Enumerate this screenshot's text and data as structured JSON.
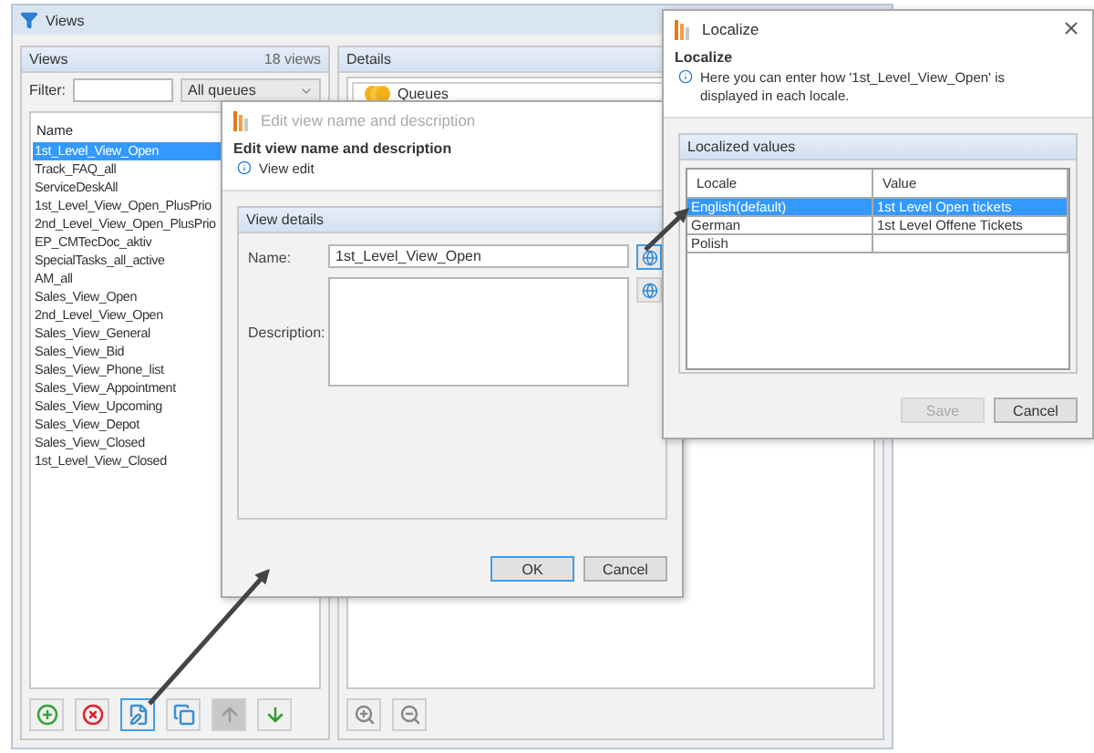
{
  "window": {
    "title": "Views"
  },
  "views_panel": {
    "title": "Views",
    "count": "18 views",
    "filter_label": "Filter:",
    "queue_select": "All queues",
    "column": "Name",
    "items": [
      {
        "label": "1st_Level_View_Open",
        "selected": true
      },
      {
        "label": "Track_FAQ_all",
        "selected": false
      },
      {
        "label": "ServiceDeskAll",
        "selected": false
      },
      {
        "label": "1st_Level_View_Open_PlusPrio",
        "selected": false
      },
      {
        "label": "2nd_Level_View_Open_PlusPrio",
        "selected": false
      },
      {
        "label": "EP_CMTecDoc_aktiv",
        "selected": false
      },
      {
        "label": "SpecialTasks_all_active",
        "selected": false
      },
      {
        "label": "AM_all",
        "selected": false
      },
      {
        "label": "Sales_View_Open",
        "selected": false
      },
      {
        "label": "2nd_Level_View_Open",
        "selected": false
      },
      {
        "label": "Sales_View_General",
        "selected": false
      },
      {
        "label": "Sales_View_Bid",
        "selected": false
      },
      {
        "label": "Sales_View_Phone_list",
        "selected": false
      },
      {
        "label": "Sales_View_Appointment",
        "selected": false
      },
      {
        "label": "Sales_View_Upcoming",
        "selected": false
      },
      {
        "label": "Sales_View_Depot",
        "selected": false
      },
      {
        "label": "Sales_View_Closed",
        "selected": false
      },
      {
        "label": "1st_Level_View_Closed",
        "selected": false
      }
    ],
    "toolbar": [
      {
        "kind": "add",
        "disabled": false,
        "selected": false
      },
      {
        "kind": "delete",
        "disabled": false,
        "selected": false
      },
      {
        "kind": "edit",
        "disabled": false,
        "selected": true
      },
      {
        "kind": "copy",
        "disabled": false,
        "selected": false
      },
      {
        "kind": "up",
        "disabled": true,
        "selected": false
      },
      {
        "kind": "down",
        "disabled": false,
        "selected": false
      }
    ]
  },
  "details_panel": {
    "title": "Details",
    "items": [
      {
        "label": "Queues"
      }
    ],
    "toolbar": [
      {
        "kind": "zoom_in"
      },
      {
        "kind": "zoom_out"
      }
    ]
  },
  "edit_dialog": {
    "title": "Edit view name and description",
    "heading": "Edit view name and description",
    "info": "View edit",
    "group": "View details",
    "name_label": "Name:",
    "name_value": "1st_Level_View_Open",
    "description_label": "Description:",
    "buttons": [
      {
        "label": "OK",
        "default": true
      },
      {
        "label": "Cancel",
        "default": false
      }
    ]
  },
  "localize_dialog": {
    "title": "Localize",
    "heading": "Localize",
    "info": "Here you can enter how '1st_Level_View_Open' is displayed in each locale.",
    "group": "Localized values",
    "columns": [
      "Locale",
      "Value"
    ],
    "rows": [
      {
        "locale": "English(default)",
        "value": "1st Level Open tickets",
        "selected": true
      },
      {
        "locale": "German",
        "value": "1st Level Offene Tickets",
        "selected": false
      },
      {
        "locale": "Polish",
        "selected": false
      }
    ],
    "buttons": [
      {
        "label": "Save",
        "disabled": true
      },
      {
        "label": "Cancel",
        "disabled": false
      }
    ]
  }
}
